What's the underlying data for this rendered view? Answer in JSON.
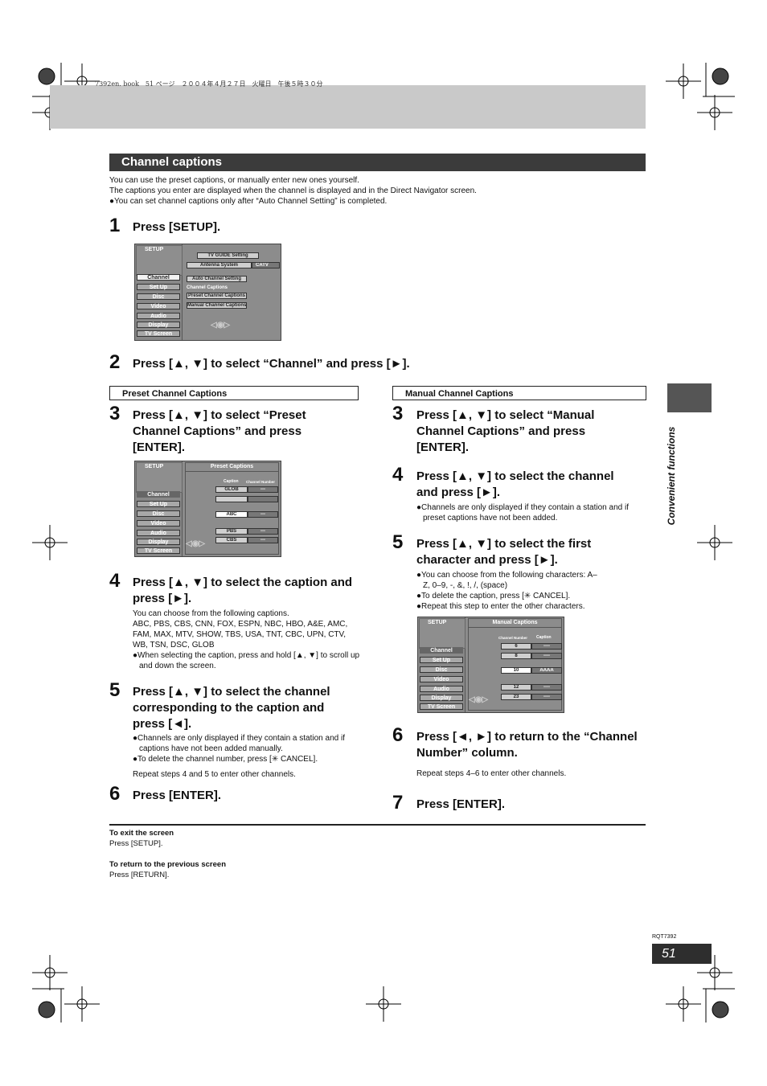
{
  "header": {
    "book_stamp": "7392en. book　51 ページ　２００４年４月２７日　火曜日　午後５時３０分"
  },
  "title": "Channel captions",
  "intro": [
    "You can use the preset captions, or manually enter new ones yourself.",
    "The captions you enter are displayed when the channel is displayed and in the Direct Navigator screen.",
    "●You can set channel captions only after “Auto Channel Setting” is completed."
  ],
  "step1": {
    "num": "1",
    "text": "Press [SETUP]."
  },
  "step2": {
    "num": "2",
    "text": "Press [▲, ▼] to select “Channel” and press [►]."
  },
  "screens": {
    "setup_label": "SETUP",
    "menu": [
      "Channel",
      "Set Up",
      "Disc",
      "Video",
      "Audio",
      "Display",
      "TV Screen"
    ],
    "s1": {
      "tv_guide": "TV GUIDE Setting",
      "antenna": "Antenna System",
      "antenna_value": "CATV",
      "auto": "Auto Channel Setting",
      "captions_label": "Channel Captions",
      "preset": "Preset Channel Captions",
      "manual": "Manual Channel Captions"
    },
    "s2": {
      "title": "Preset Captions",
      "col1": "Caption",
      "col2": "Channel Number",
      "rows": [
        [
          "GLOB",
          "---"
        ],
        [
          "",
          ""
        ],
        [
          "ABC",
          "---"
        ],
        [
          "PBS",
          "---"
        ],
        [
          "CBS",
          "---"
        ]
      ]
    },
    "s3": {
      "title": "Manual Captions",
      "col1": "Channel Number",
      "col2": "Caption",
      "rows": [
        [
          "6",
          "----"
        ],
        [
          "8",
          "----"
        ],
        [
          "10",
          "AAAA"
        ],
        [
          "12",
          "----"
        ],
        [
          "23",
          "----"
        ]
      ]
    }
  },
  "left": {
    "heading": "Preset Channel Captions",
    "s3": {
      "num": "3",
      "text": "Press [▲, ▼] to select “Preset\nChannel Captions” and press\n[ENTER]."
    },
    "s4": {
      "num": "4",
      "text": "Press [▲, ▼] to select the caption and\npress [►].",
      "body": [
        "You can choose from the following captions.",
        "ABC, PBS, CBS, CNN, FOX, ESPN, NBC, HBO, A&E, AMC,",
        "FAM, MAX, MTV, SHOW, TBS, USA, TNT, CBC, UPN, CTV,",
        "WB, TSN, DSC, GLOB"
      ],
      "bullet": "●When selecting the caption, press and hold [▲, ▼] to scroll up and down the screen."
    },
    "s5": {
      "num": "5",
      "text": "Press [▲, ▼] to select the channel\ncorresponding to the caption and\npress [◄].",
      "bullets": [
        "●Channels are only displayed if they contain a station and if captions have not been added manually.",
        "●To delete the channel number, press [✳ CANCEL]."
      ],
      "repeat": "Repeat steps 4 and 5 to enter other channels."
    },
    "s6": {
      "num": "6",
      "text": "Press [ENTER]."
    }
  },
  "right": {
    "heading": "Manual Channel Captions",
    "s3": {
      "num": "3",
      "text": "Press [▲, ▼] to select “Manual\nChannel Captions” and press\n[ENTER]."
    },
    "s4": {
      "num": "4",
      "text": "Press [▲, ▼] to select the channel\nand press [►].",
      "bullet": "●Channels are only displayed if they contain a station and if preset captions have not been added."
    },
    "s5": {
      "num": "5",
      "text": "Press [▲, ▼] to select the first\ncharacter and press [►].",
      "bullets": [
        "●You can choose from the following characters: A–Z, 0–9, -, &, !, /, (space)",
        "●To delete the caption, press [✳ CANCEL].",
        "●Repeat this step to enter the other characters."
      ]
    },
    "s6": {
      "num": "6",
      "text": "Press [◄, ►] to return to the “Channel\nNumber” column.",
      "repeat": "Repeat steps 4–6 to enter other channels."
    },
    "s7": {
      "num": "7",
      "text": "Press [ENTER]."
    }
  },
  "footer": {
    "exit_title": "To exit the screen",
    "exit_text": "Press [SETUP].",
    "return_title": "To return to the previous screen",
    "return_text": "Press [RETURN]."
  },
  "sidebar": {
    "label": "Convenient functions"
  },
  "doc_code": "RQT7392",
  "page_number": "51"
}
